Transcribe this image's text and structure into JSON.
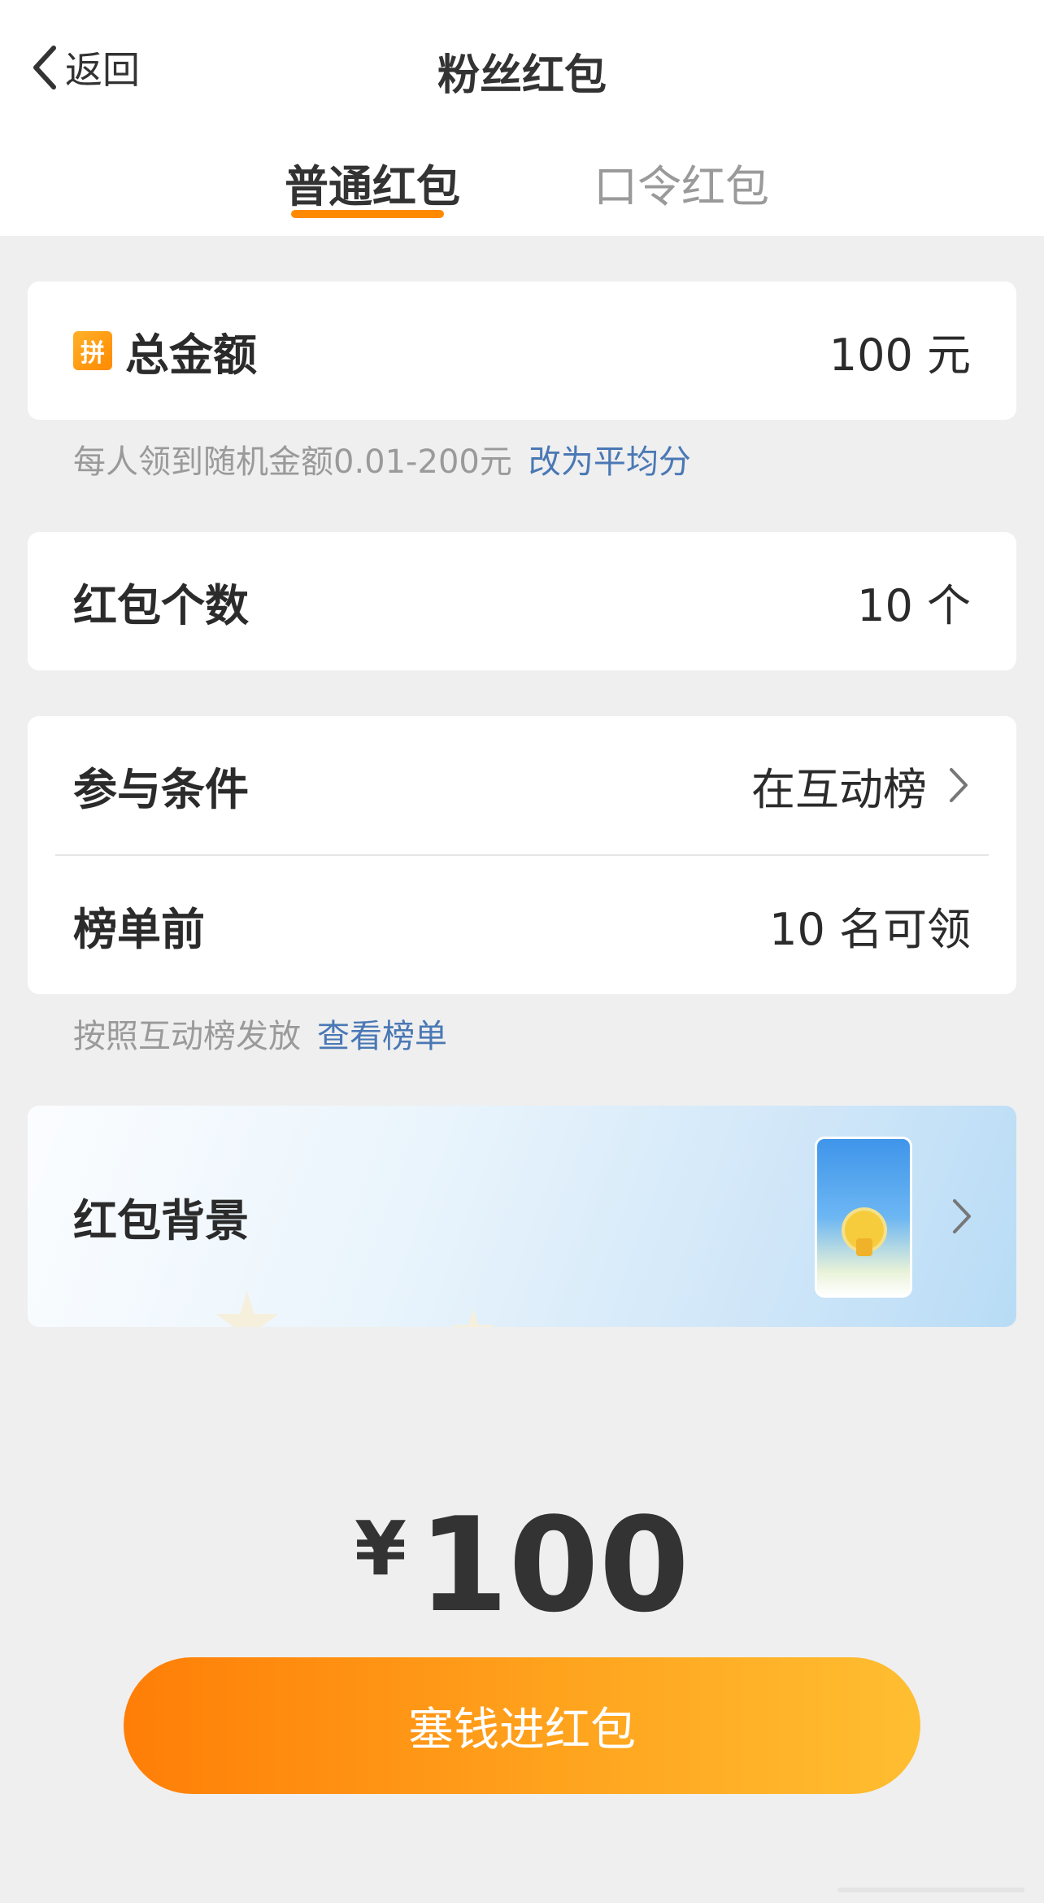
{
  "header": {
    "back_label": "返回",
    "title": "粉丝红包"
  },
  "tabs": [
    {
      "label": "普通红包",
      "active": true
    },
    {
      "label": "口令红包",
      "active": false
    }
  ],
  "total_amount": {
    "badge": "拼",
    "label": "总金额",
    "value": "100 元",
    "hint": "每人领到随机金额0.01-200元",
    "hint_link": "改为平均分"
  },
  "count": {
    "label": "红包个数",
    "value": "10 个"
  },
  "condition": {
    "label": "参与条件",
    "value": "在互动榜",
    "rank_label": "榜单前",
    "rank_value": "10 名可领",
    "hint": "按照互动榜发放",
    "hint_link": "查看榜单"
  },
  "background": {
    "label": "红包背景",
    "thumbnail_icon": "mascot-thumbnail"
  },
  "price": {
    "currency": "¥",
    "amount": "100"
  },
  "cta": {
    "label": "塞钱进红包"
  },
  "colors": {
    "accent": "#ff8a00",
    "link": "#4a78b5",
    "page_bg": "#efefef"
  }
}
